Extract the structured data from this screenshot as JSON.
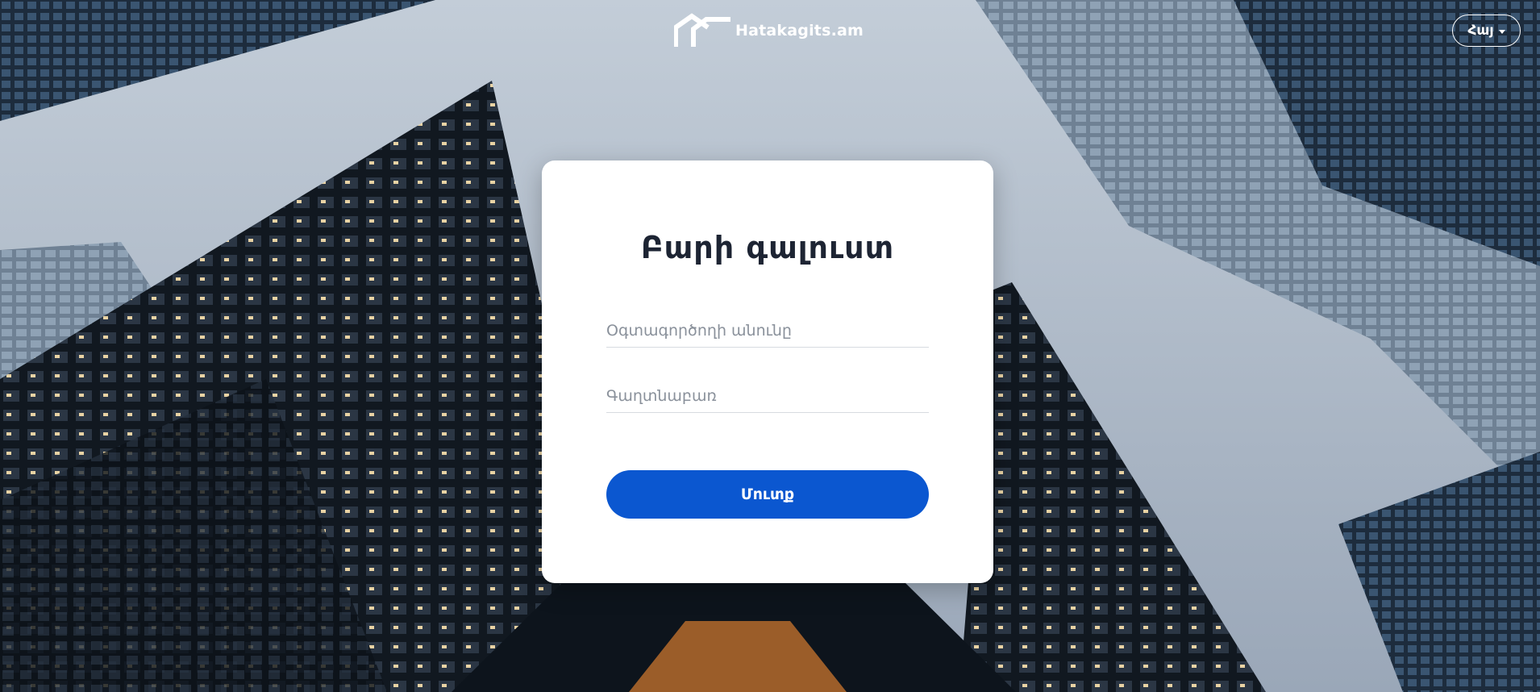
{
  "header": {
    "logo_text": "Hatakagits.am",
    "logo_icon": "houses-icon",
    "language_label": "Հայ"
  },
  "login": {
    "title": "Բարի գալուստ",
    "username_placeholder": "Օգտագործողի անունը",
    "username_value": "",
    "password_placeholder": "Գաղտնաբառ",
    "password_value": "",
    "submit_label": "Մուտք"
  },
  "colors": {
    "primary": "#0b57d0",
    "title_text": "#1d2433",
    "card_background": "#ffffff"
  }
}
